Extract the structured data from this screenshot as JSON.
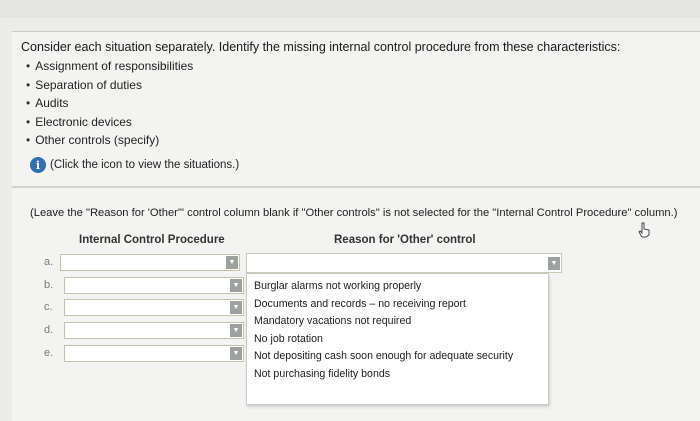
{
  "question": {
    "prompt": "Consider each situation separately. Identify the missing internal control procedure from these characteristics:",
    "characteristics": [
      "Assignment of responsibilities",
      "Separation of duties",
      "Audits",
      "Electronic devices",
      "Other controls (specify)"
    ],
    "info_text": "(Click the icon to view the situations.)",
    "info_icon": "i"
  },
  "table": {
    "note": "(Leave the \"Reason for 'Other'\" control column blank if \"Other controls\" is not selected for the \"Internal Control Procedure\" column.)",
    "headers": {
      "procedure": "Internal Control Procedure",
      "reason": "Reason for 'Other' control"
    },
    "rows": [
      {
        "label": "a."
      },
      {
        "label": "b."
      },
      {
        "label": "c."
      },
      {
        "label": "d."
      },
      {
        "label": "e."
      }
    ],
    "dropdown_arrow": "▼"
  },
  "reason_dropdown": {
    "options": [
      "Burglar alarms not working properly",
      "Documents and records – no receiving report",
      "Mandatory vacations not required",
      "No job rotation",
      "Not depositing cash soon enough for adequate security",
      "Not purchasing fidelity bonds"
    ]
  }
}
